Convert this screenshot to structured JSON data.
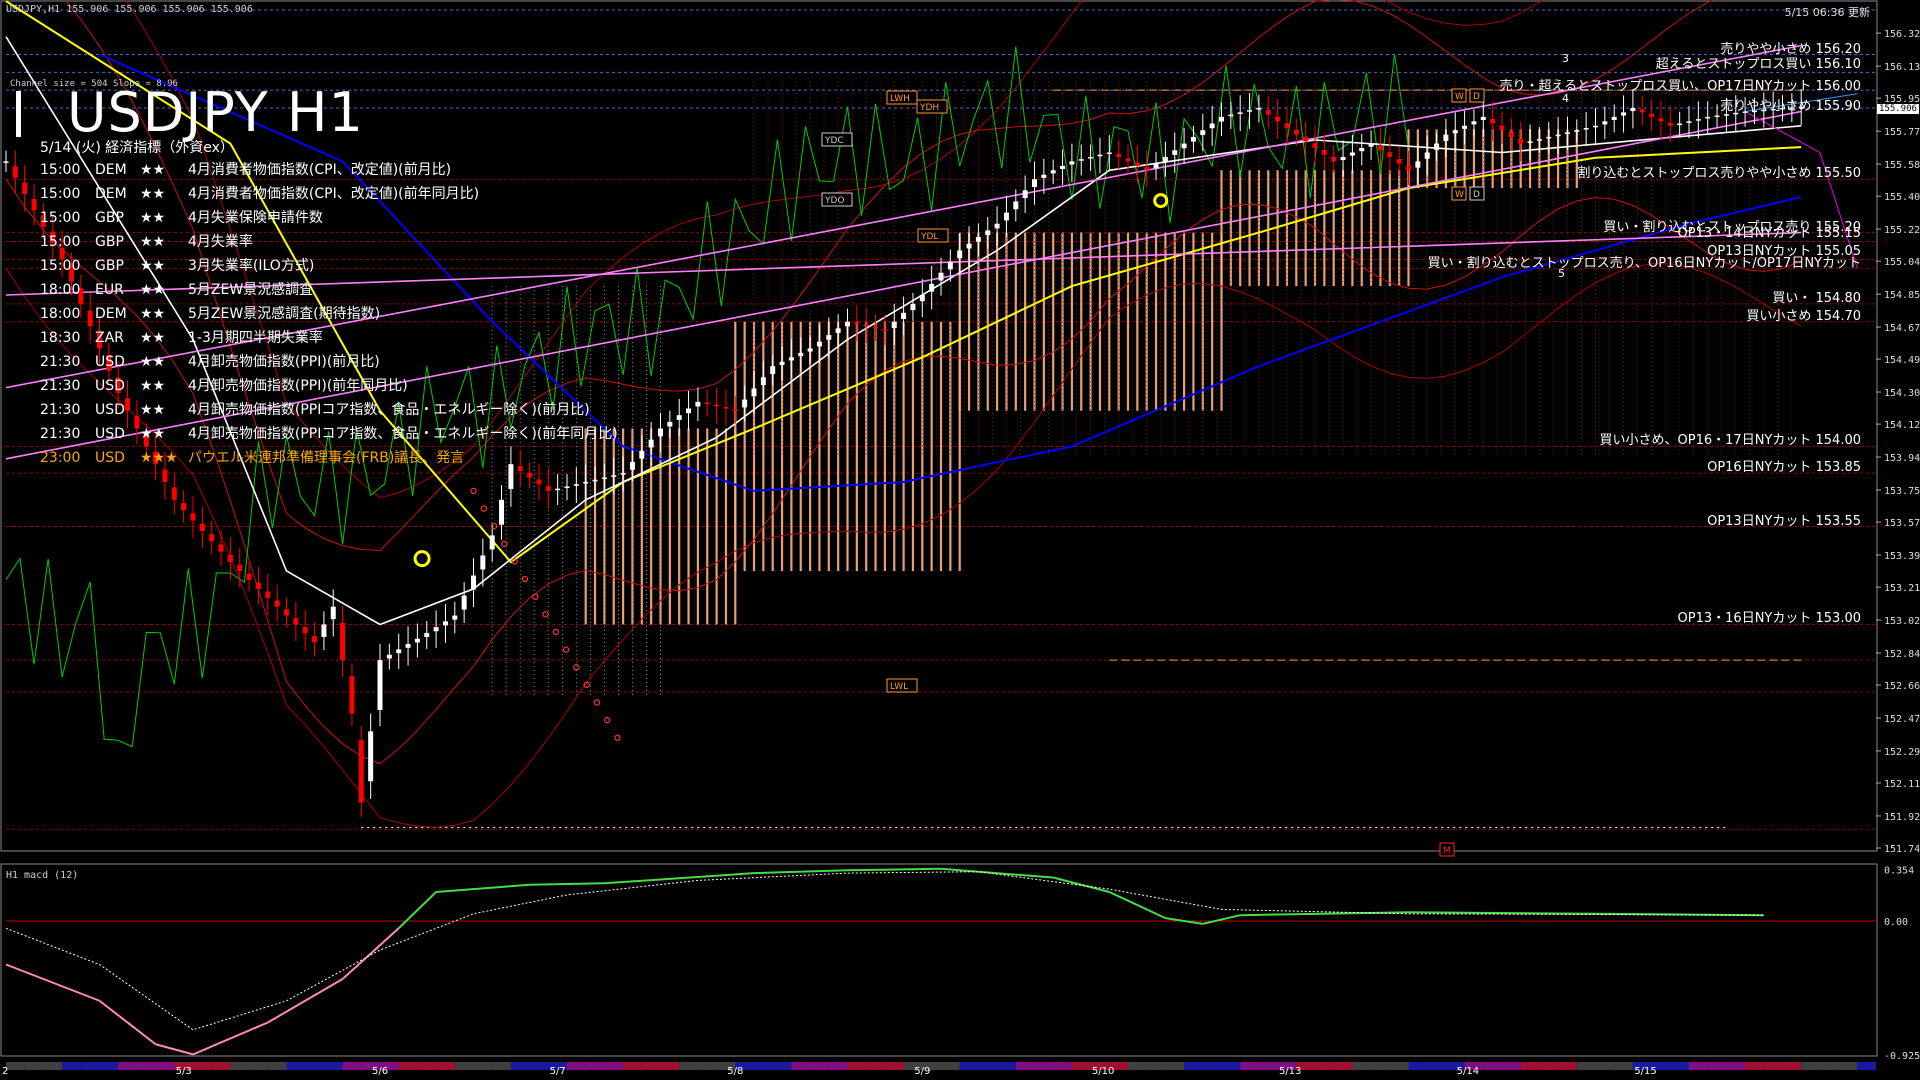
{
  "header": {
    "symbol_line": "USDJPY,H1  155.906 155.906 155.906 155.906",
    "updated": "5/15 06:36 更新",
    "channel_info": "Channel size = 504 Slope = 8.96",
    "title": "USDJPY H1",
    "subtitle": "5/14 (火) 経済指標（外資ex）"
  },
  "events": [
    {
      "time": "15:00",
      "ccy": "DEM",
      "stars": "★★",
      "name": "4月消費者物価指数(CPI、改定値)(前月比)"
    },
    {
      "time": "15:00",
      "ccy": "DEM",
      "stars": "★★",
      "name": "4月消費者物価指数(CPI、改定値)(前年同月比)"
    },
    {
      "time": "15:00",
      "ccy": "GBP",
      "stars": "★★",
      "name": "4月失業保険申請件数"
    },
    {
      "time": "15:00",
      "ccy": "GBP",
      "stars": "★★",
      "name": "4月失業率"
    },
    {
      "time": "15:00",
      "ccy": "GBP",
      "stars": "★★",
      "name": "3月失業率(ILO方式)"
    },
    {
      "time": "18:00",
      "ccy": "EUR",
      "stars": "★★",
      "name": "5月ZEW景況感調査"
    },
    {
      "time": "18:00",
      "ccy": "DEM",
      "stars": "★★",
      "name": "5月ZEW景況感調査(期待指数)"
    },
    {
      "time": "18:30",
      "ccy": "ZAR",
      "stars": "★★",
      "name": "1-3月期四半期失業率"
    },
    {
      "time": "21:30",
      "ccy": "USD",
      "stars": "★★",
      "name": "4月卸売物価指数(PPI)(前月比)"
    },
    {
      "time": "21:30",
      "ccy": "USD",
      "stars": "★★",
      "name": "4月卸売物価指数(PPI)(前年同月比)"
    },
    {
      "time": "21:30",
      "ccy": "USD",
      "stars": "★★",
      "name": "4月卸売物価指数(PPIコア指数、食品・エネルギー除く)(前月比)"
    },
    {
      "time": "21:30",
      "ccy": "USD",
      "stars": "★★",
      "name": "4月卸売物価指数(PPIコア指数、食品・エネルギー除く)(前年同月比)"
    },
    {
      "time": "23:00",
      "ccy": "USD",
      "stars": "★★★",
      "name": "パウエル米連邦準備理事会(FRB)議長、発言",
      "highlight": true
    }
  ],
  "order_labels": [
    {
      "text": "売りやや小さめ 156.20",
      "price": 156.2
    },
    {
      "text": "超えるとストップロス買い 156.10",
      "price": 156.1
    },
    {
      "text": "売り・超えるとストップロス買い、OP17日NYカット 156.00",
      "price": 156.0
    },
    {
      "text": "売りやや小さめ 155.90",
      "price": 155.9
    },
    {
      "text": "割り込むとストップロス売りやや小さめ 155.50",
      "price": 155.5
    },
    {
      "text": "買い・割り込むとストップロス売り 155.20",
      "price": 155.2
    },
    {
      "text": "OP13・14日NYカット 155.15",
      "price": 155.15
    },
    {
      "text": "OP13日NYカット 155.05",
      "price": 155.05
    },
    {
      "text": "買い・割り込むとストップロス売り、OP16日NYカット/OP17日NYカット",
      "price": 155.0
    },
    {
      "text": "買い・ 154.80",
      "price": 154.8
    },
    {
      "text": "買い小さめ 154.70",
      "price": 154.7
    },
    {
      "text": "買い小さめ、OP16・17日NYカット 154.00",
      "price": 154.0
    },
    {
      "text": "OP16日NYカット 153.85",
      "price": 153.85
    },
    {
      "text": "OP13日NYカット 153.55",
      "price": 153.55
    },
    {
      "text": "OP13・16日NYカット 153.00",
      "price": 153.0
    }
  ],
  "markers": {
    "LWH": "LWH",
    "YDH": "YDH",
    "YDC": "YDC",
    "YDO": "YDO",
    "YDL": "YDL",
    "LWL": "LWL",
    "W": "W",
    "D": "D",
    "M": "M",
    "n3": "3",
    "n4": "4",
    "n5": "5"
  },
  "current_price": "155.906",
  "macd": {
    "label": "H1  macd (12)",
    "ticks": [
      "0.354",
      "0.00",
      "-0.925"
    ]
  },
  "colors": {
    "background": "#000000",
    "bull": "#ffffff",
    "bear": "#ff0000",
    "kumo": "#ffb27f",
    "ma_yellow": "#ffff00",
    "ma_blue": "#0000ff",
    "channel": "#ff80ff",
    "chikou": "#00cc00",
    "grid_red": "#c00000",
    "grid_blue": "#6080ff"
  },
  "chart_data": {
    "type": "candlestick",
    "symbol": "USDJPY",
    "timeframe": "H1",
    "yticks": [
      "156.320",
      "156.135",
      "155.955",
      "155.770",
      "155.585",
      "155.405",
      "155.220",
      "155.040",
      "154.855",
      "154.670",
      "154.490",
      "154.305",
      "154.125",
      "153.940",
      "153.755",
      "153.575",
      "153.390",
      "153.210",
      "153.025",
      "152.840",
      "152.660",
      "152.475",
      "152.290",
      "152.110",
      "151.925",
      "151.745"
    ],
    "ylim": [
      151.745,
      156.45
    ],
    "xticks": [
      "5/3",
      "5/6",
      "5/7",
      "5/8",
      "5/9",
      "5/10",
      "5/13",
      "5/14",
      "5/15"
    ],
    "first_tick": "2",
    "price_path": [
      [
        0,
        155.6
      ],
      [
        6,
        155.05
      ],
      [
        12,
        154.3
      ],
      [
        18,
        153.7
      ],
      [
        24,
        153.35
      ],
      [
        30,
        153.05
      ],
      [
        33,
        152.9
      ],
      [
        35,
        153.1
      ],
      [
        37,
        152.5
      ],
      [
        38,
        152.0
      ],
      [
        40,
        152.8
      ],
      [
        44,
        152.92
      ],
      [
        48,
        153.05
      ],
      [
        52,
        153.5
      ],
      [
        54,
        153.9
      ],
      [
        58,
        153.75
      ],
      [
        62,
        153.8
      ],
      [
        66,
        153.85
      ],
      [
        70,
        154.1
      ],
      [
        74,
        154.25
      ],
      [
        78,
        154.2
      ],
      [
        82,
        154.45
      ],
      [
        86,
        154.55
      ],
      [
        90,
        154.7
      ],
      [
        94,
        154.65
      ],
      [
        98,
        154.85
      ],
      [
        102,
        155.1
      ],
      [
        106,
        155.25
      ],
      [
        110,
        155.5
      ],
      [
        114,
        155.6
      ],
      [
        118,
        155.65
      ],
      [
        122,
        155.55
      ],
      [
        126,
        155.7
      ],
      [
        130,
        155.85
      ],
      [
        134,
        155.9
      ],
      [
        138,
        155.75
      ],
      [
        142,
        155.6
      ],
      [
        146,
        155.7
      ],
      [
        150,
        155.55
      ],
      [
        154,
        155.75
      ],
      [
        158,
        155.85
      ],
      [
        162,
        155.7
      ],
      [
        166,
        155.75
      ],
      [
        170,
        155.8
      ],
      [
        174,
        155.9
      ],
      [
        178,
        155.8
      ],
      [
        182,
        155.85
      ],
      [
        186,
        155.88
      ],
      [
        190,
        155.9
      ],
      [
        192,
        155.906
      ]
    ],
    "lines": {
      "channel_upper": [
        [
          0,
          154.33
        ],
        [
          192,
          156.25
        ]
      ],
      "channel_mid": [
        [
          0,
          153.93
        ],
        [
          192,
          155.88
        ]
      ],
      "channel_lower": [
        [
          0,
          154.85
        ],
        [
          192,
          155.2
        ]
      ],
      "ma_yellow": [
        [
          0,
          156.5
        ],
        [
          24,
          155.7
        ],
        [
          40,
          154.2
        ],
        [
          54,
          153.35
        ],
        [
          66,
          153.8
        ],
        [
          80,
          154.1
        ],
        [
          98,
          154.5
        ],
        [
          114,
          154.9
        ],
        [
          134,
          155.2
        ],
        [
          150,
          155.45
        ],
        [
          170,
          155.62
        ],
        [
          192,
          155.68
        ]
      ],
      "ma_blue": [
        [
          10,
          156.2
        ],
        [
          36,
          155.6
        ],
        [
          52,
          154.7
        ],
        [
          66,
          154.0
        ],
        [
          80,
          153.75
        ],
        [
          96,
          153.8
        ],
        [
          114,
          154.0
        ],
        [
          134,
          154.45
        ],
        [
          160,
          154.95
        ],
        [
          180,
          155.25
        ],
        [
          192,
          155.4
        ]
      ],
      "ma_white": [
        [
          0,
          156.3
        ],
        [
          20,
          154.6
        ],
        [
          30,
          153.3
        ],
        [
          40,
          153.0
        ],
        [
          50,
          153.2
        ],
        [
          62,
          153.7
        ],
        [
          76,
          154.05
        ],
        [
          90,
          154.6
        ],
        [
          106,
          155.1
        ],
        [
          118,
          155.55
        ],
        [
          140,
          155.72
        ],
        [
          160,
          155.65
        ],
        [
          192,
          155.8
        ]
      ]
    },
    "kumo_ranges": [
      {
        "from": 62,
        "to": 78,
        "lo": 153.0,
        "hi": 154.1
      },
      {
        "from": 78,
        "to": 102,
        "lo": 153.3,
        "hi": 154.7
      },
      {
        "from": 102,
        "to": 130,
        "lo": 154.2,
        "hi": 155.2
      },
      {
        "from": 130,
        "to": 150,
        "lo": 154.9,
        "hi": 155.55
      },
      {
        "from": 150,
        "to": 168,
        "lo": 155.45,
        "hi": 155.78
      }
    ],
    "level_lines": [
      156.45,
      156.2,
      156.1,
      156.0,
      155.9,
      155.5,
      155.2,
      155.15,
      155.05,
      155.0,
      154.8,
      154.7,
      154.0,
      153.85,
      153.55,
      153.0,
      152.8,
      152.62,
      151.85
    ],
    "macd_series": [
      [
        0,
        -0.3
      ],
      [
        10,
        -0.55
      ],
      [
        16,
        -0.85
      ],
      [
        20,
        -0.92
      ],
      [
        28,
        -0.7
      ],
      [
        36,
        -0.4
      ],
      [
        42,
        -0.05
      ],
      [
        46,
        0.2
      ],
      [
        56,
        0.25
      ],
      [
        64,
        0.26
      ],
      [
        80,
        0.33
      ],
      [
        90,
        0.35
      ],
      [
        100,
        0.36
      ],
      [
        112,
        0.3
      ],
      [
        118,
        0.2
      ],
      [
        124,
        0.02
      ],
      [
        128,
        -0.02
      ],
      [
        132,
        0.04
      ],
      [
        150,
        0.06
      ],
      [
        170,
        0.05
      ],
      [
        188,
        0.04
      ]
    ],
    "signal_series": [
      [
        0,
        -0.05
      ],
      [
        10,
        -0.3
      ],
      [
        20,
        -0.75
      ],
      [
        30,
        -0.55
      ],
      [
        40,
        -0.2
      ],
      [
        50,
        0.05
      ],
      [
        60,
        0.18
      ],
      [
        74,
        0.28
      ],
      [
        90,
        0.33
      ],
      [
        104,
        0.34
      ],
      [
        118,
        0.22
      ],
      [
        130,
        0.08
      ],
      [
        150,
        0.05
      ],
      [
        188,
        0.04
      ]
    ]
  }
}
